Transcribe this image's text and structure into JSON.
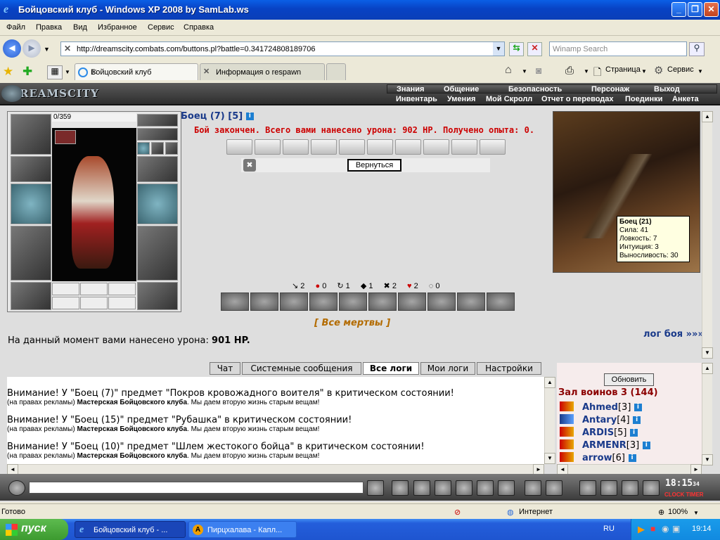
{
  "window": {
    "title": "Бойцовский клуб - Windows XP 2008 by SamLab.ws"
  },
  "menu": [
    "Файл",
    "Правка",
    "Вид",
    "Избранное",
    "Сервис",
    "Справка"
  ],
  "address": {
    "url": "http://dreamscity.combats.com/buttons.pl?battle=0.341724808189706",
    "search_placeholder": "Winamp Search"
  },
  "tabs": [
    {
      "label": "Бойцовский клуб"
    },
    {
      "label": "Информация о respawn"
    }
  ],
  "toolbar": {
    "page_label": "Страница",
    "service_label": "Сервис"
  },
  "game": {
    "logo": "DREAMSCITY",
    "topmenu": [
      "Знания",
      "Общение",
      "Безопасность",
      "Персонаж",
      "Выход"
    ],
    "submenu": [
      "Инвентарь",
      "Умения",
      "Мой Скролл",
      "Отчет о переводах",
      "Поединки",
      "Анкета"
    ],
    "hp": "0/359",
    "hp_fraction": 0,
    "fighter": "Боец (7) [5]",
    "result": "Бой закончен. Всего вами нанесено урона: 902 HP. Получено опыта: 0.",
    "back_button": "Вернуться",
    "stats": [
      "2",
      "0",
      "1",
      "1",
      "2",
      "2",
      "0"
    ],
    "all_dead": "[ Все мертвы ]",
    "damage_now_prefix": "На данный момент вами нанесено урона:",
    "damage_now_value": "901 HP.",
    "log_link": "лог боя »»»",
    "opponent_tip": {
      "name": "Боец (21)",
      "lines": [
        "Сила: 41",
        "Ловкость: 7",
        "Интуиция: 3",
        "Выносливость: 30"
      ]
    }
  },
  "logtabs": [
    "Чат",
    "Системные сообщения",
    "Все логи",
    "Мои логи",
    "Настройки"
  ],
  "logs": [
    {
      "msg": "Внимание! У \"Боец (7)\" предмет \"Покров кровожадного воителя\" в критическом состоянии!",
      "ad_prefix": "(на правах рекламы)",
      "ad_name": "Мастерская Бойцовского клуба",
      "ad_text": ". Мы даем вторую жизнь старым вещам!"
    },
    {
      "msg": "Внимание! У \"Боец (15)\" предмет \"Рубашка\" в критическом состоянии!",
      "ad_prefix": "(на правах рекламы)",
      "ad_name": "Мастерская Бойцовского клуба",
      "ad_text": ". Мы даем вторую жизнь старым вещам!"
    },
    {
      "msg": "Внимание! У \"Боец (10)\" предмет \"Шлем жестокого бойца\" в критическом состоянии!",
      "ad_prefix": "(на правах рекламы)",
      "ad_name": "Мастерская Бойцовского клуба",
      "ad_text": ". Мы даем вторую жизнь старым вещам!"
    }
  ],
  "room": {
    "refresh": "Обновить",
    "title": "Зал воинов 3 (144)",
    "players": [
      {
        "name": "Ahmed",
        "level": "[3]"
      },
      {
        "name": "Antary",
        "level": "[4]"
      },
      {
        "name": "ARDIS",
        "level": "[5]"
      },
      {
        "name": "ARMENR",
        "level": "[3]"
      },
      {
        "name": "arrow",
        "level": "[6]"
      }
    ]
  },
  "clock": {
    "time": "18:15",
    "sec": "34",
    "label": "CLOCK TIMER"
  },
  "status": {
    "ready": "Готово",
    "zone": "Интернет",
    "zoom": "100%"
  },
  "taskbar": {
    "start": "пуск",
    "tasks": [
      "Бойцовский клуб - ...",
      "Пирцхалава - Капл..."
    ],
    "lang": "RU",
    "time": "19:14"
  }
}
